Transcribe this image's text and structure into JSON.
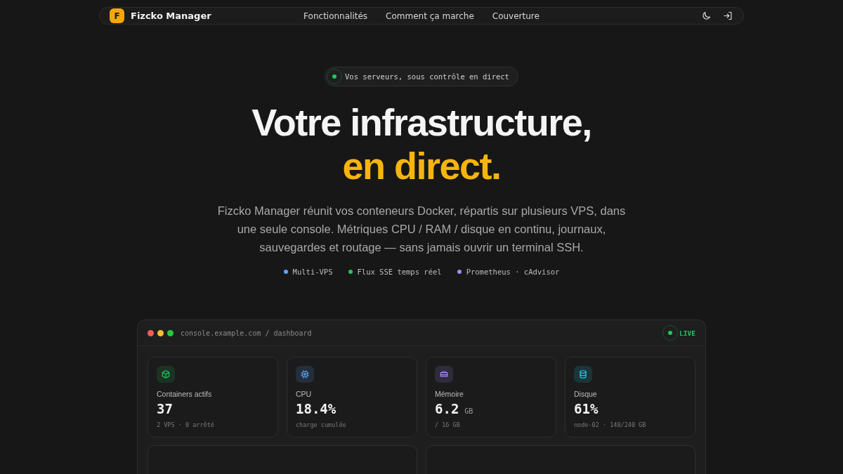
{
  "nav": {
    "logo_letter": "F",
    "brand": "Fizcko Manager",
    "links": [
      "Fonctionnalités",
      "Comment ça marche",
      "Couverture"
    ]
  },
  "hero": {
    "badge": "Vos serveurs, sous contrôle en direct",
    "title_line": "Votre infrastructure,",
    "title_accent": "en direct.",
    "description": "Fizcko Manager réunit vos conteneurs Docker, répartis sur plusieurs VPS, dans une seule console. Métriques CPU / RAM / disque en continu, journaux, sauvegardes et routage — sans jamais ouvrir un terminal SSH.",
    "tags": [
      {
        "label": "Multi-VPS",
        "color": "#60a5fa"
      },
      {
        "label": "Flux SSE temps réel",
        "color": "#22c55e"
      },
      {
        "label": "Prometheus · cAdvisor",
        "color": "#a78bfa"
      }
    ]
  },
  "console": {
    "url": "console.example.com / dashboard",
    "status": "LIVE",
    "stats": [
      {
        "kind": "box",
        "color": "#22c55e",
        "label": "Containers actifs",
        "value": "37",
        "sub": "2 VPS · 0 arrêté"
      },
      {
        "kind": "chip",
        "color": "#60a5fa",
        "label": "CPU",
        "value": "18.4%",
        "sub": "charge cumulée"
      },
      {
        "kind": "memory",
        "color": "#a78bfa",
        "label": "Mémoire",
        "value": "6.2",
        "unit": "GB",
        "sub": "/ 16 GB"
      },
      {
        "kind": "disk",
        "color": "#22d3ee",
        "label": "Disque",
        "value": "61%",
        "sub": "node-02 · 148/240 GB"
      }
    ]
  }
}
